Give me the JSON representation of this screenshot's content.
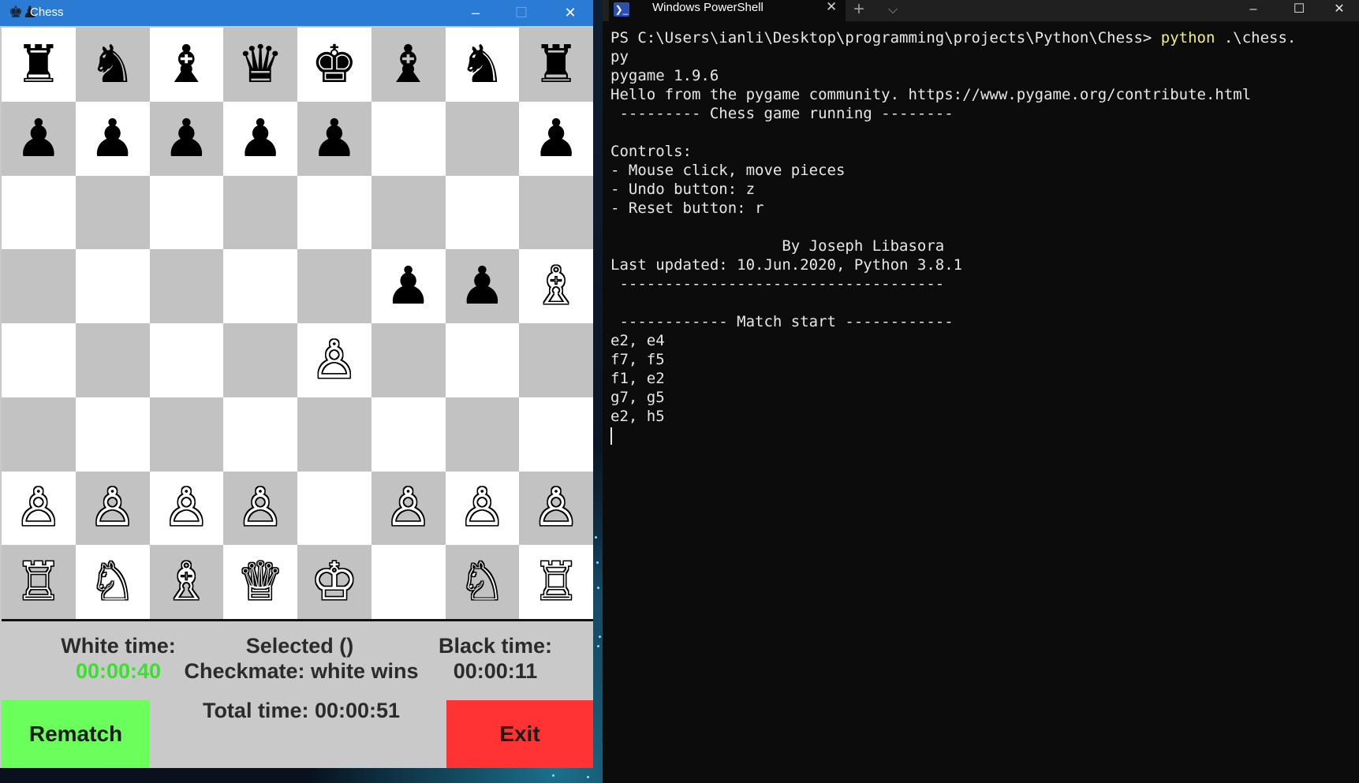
{
  "chess_window": {
    "title": "Chess",
    "app_icon": "♚♟",
    "min_glyph": "–",
    "max_glyph": "☐",
    "close_glyph": "✕",
    "board": [
      [
        "♜",
        "♞",
        "♝",
        "♛",
        "♚",
        "♝",
        "♞",
        "♜"
      ],
      [
        "♟",
        "♟",
        "♟",
        "♟",
        "♟",
        "",
        "",
        "♟"
      ],
      [
        "",
        "",
        "",
        "",
        "",
        "",
        "",
        ""
      ],
      [
        "",
        "",
        "",
        "",
        "",
        "♟",
        "♟",
        "♗"
      ],
      [
        "",
        "",
        "",
        "",
        "♙",
        "",
        "",
        ""
      ],
      [
        "",
        "",
        "",
        "",
        "",
        "",
        "",
        ""
      ],
      [
        "♙",
        "♙",
        "♙",
        "♙",
        "",
        "♙",
        "♙",
        "♙"
      ],
      [
        "♖",
        "♘",
        "♗",
        "♕",
        "♔",
        "",
        "♘",
        "♖"
      ]
    ],
    "status": {
      "white_time_label": "White time:",
      "white_time_value": "00:00:40",
      "selected_label": "Selected ()",
      "checkmate_label": "Checkmate: white wins",
      "black_time_label": "Black time:",
      "black_time_value": "00:00:11",
      "total_time_label": "Total time: 00:00:51"
    },
    "buttons": {
      "rematch": "Rematch",
      "exit": "Exit"
    },
    "colors": {
      "titlebar": "#2a7bd4",
      "light_square": "#ffffff",
      "dark_square": "#c2c2c2",
      "white_time": "#38e22a",
      "rematch": "#6bff5c",
      "exit": "#ff3333"
    }
  },
  "powershell": {
    "tab_icon": "❯_",
    "tab_title": "Windows PowerShell",
    "tab_close_glyph": "✕",
    "new_tab_glyph": "+",
    "dropdown_glyph": "⌵",
    "min_glyph": "–",
    "max_glyph": "☐",
    "close_glyph": "✕",
    "prompt": "PS C:\\Users\\ianli\\Desktop\\programming\\projects\\Python\\Chess> ",
    "command": "python",
    "command_args": " .\\chess.",
    "lines": [
      "py",
      "pygame 1.9.6",
      "Hello from the pygame community. https://www.pygame.org/contribute.html",
      " --------- Chess game running --------",
      "",
      "Controls:",
      "- Mouse click, move pieces",
      "- Undo button: z",
      "- Reset button: r",
      "",
      "                   By Joseph Libasora",
      "Last updated: 10.Jun.2020, Python 3.8.1",
      " ------------------------------------",
      "",
      " ------------ Match start ------------",
      "e2, e4",
      "f7, f5",
      "f1, e2",
      "g7, g5",
      "e2, h5"
    ]
  }
}
